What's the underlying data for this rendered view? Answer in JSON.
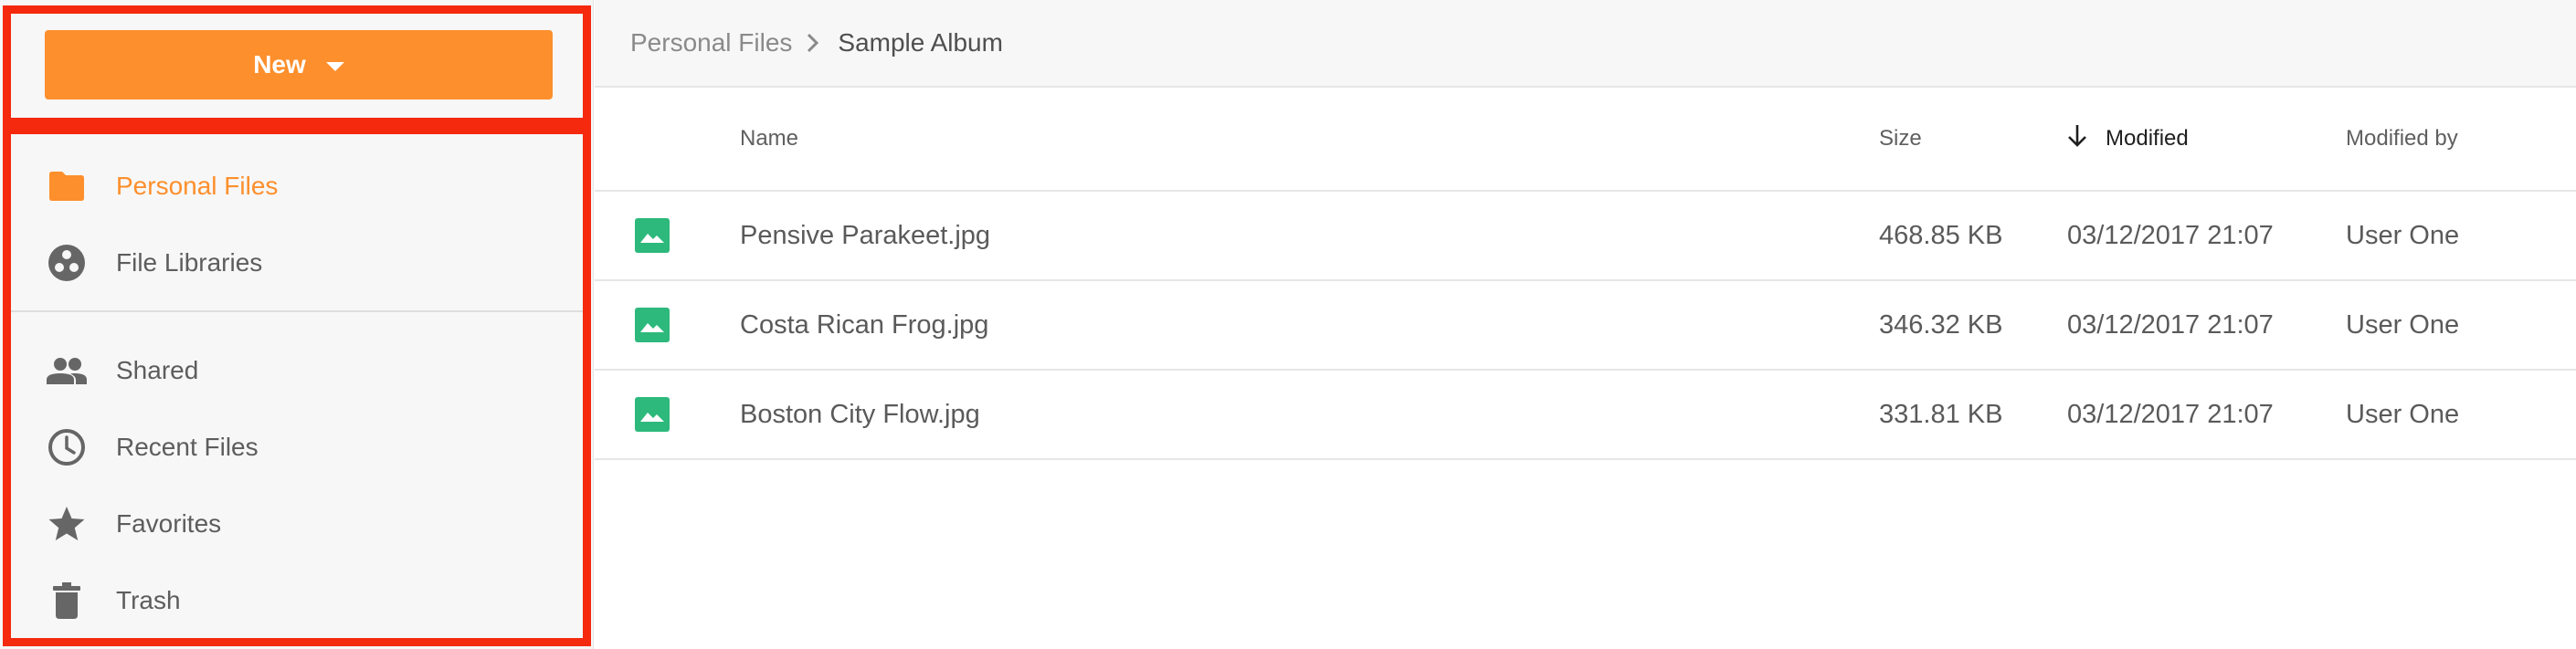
{
  "sidebar": {
    "new_button": {
      "label": "New",
      "icon": "caret-down-icon"
    },
    "primary_items": [
      {
        "label": "Personal Files",
        "icon": "folder-icon",
        "active": true
      },
      {
        "label": "File Libraries",
        "icon": "libraries-icon",
        "active": false
      }
    ],
    "secondary_items": [
      {
        "label": "Shared",
        "icon": "people-icon"
      },
      {
        "label": "Recent Files",
        "icon": "clock-icon"
      },
      {
        "label": "Favorites",
        "icon": "star-icon"
      },
      {
        "label": "Trash",
        "icon": "trash-icon"
      }
    ]
  },
  "breadcrumb": {
    "root": "Personal Files",
    "current": "Sample Album"
  },
  "table": {
    "columns": {
      "name": "Name",
      "size": "Size",
      "modified": "Modified",
      "modified_by": "Modified by"
    },
    "sort": {
      "column": "Modified",
      "direction": "descending"
    },
    "rows": [
      {
        "name": "Pensive Parakeet.jpg",
        "size": "468.85 KB",
        "modified": "03/12/2017 21:07",
        "modified_by": "User One",
        "icon": "image-icon"
      },
      {
        "name": "Costa Rican Frog.jpg",
        "size": "346.32 KB",
        "modified": "03/12/2017 21:07",
        "modified_by": "User One",
        "icon": "image-icon"
      },
      {
        "name": "Boston City Flow.jpg",
        "size": "331.81 KB",
        "modified": "03/12/2017 21:07",
        "modified_by": "User One",
        "icon": "image-icon"
      }
    ]
  },
  "colors": {
    "accent": "#fd8f2c",
    "highlight_border": "#f4290d",
    "file_icon": "#2db97c",
    "sidebar_bg": "#f7f7f7"
  }
}
